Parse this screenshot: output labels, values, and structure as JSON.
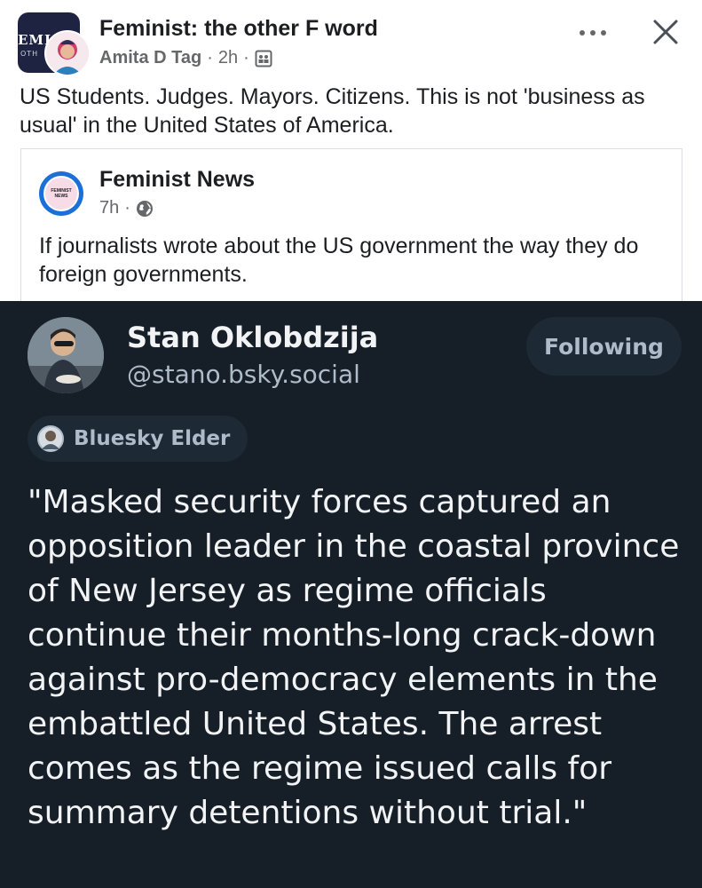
{
  "header": {
    "group_name": "Feminist: the other F word",
    "group_avatar_text": "EMI",
    "group_avatar_sub": "OTH",
    "author": "Amita D Tag",
    "separator": "·",
    "time": "2h",
    "audience_icon": "group-icon",
    "more_icon": "more-icon",
    "close_icon": "close-icon"
  },
  "post": {
    "text": "US Students. Judges. Mayors. Citizens. This is not 'business as usual' in the United States of America."
  },
  "shared": {
    "avatar_text_line1": "FEMINIST",
    "avatar_text_line2": "NEWS",
    "name": "Feminist News",
    "time": "7h",
    "separator": "·",
    "audience_icon": "globe-icon",
    "text": "If journalists wrote about the US government the way they do foreign governments."
  },
  "bluesky": {
    "name": "Stan Oklobdzija",
    "handle": "@stano.bsky.social",
    "follow_label": "Following",
    "badge_label": "Bluesky Elder",
    "lines": [
      "\"Masked security forces captured an",
      "opposition leader in the coastal province",
      "of New Jersey as regime officials",
      "continue their months-long crack-down",
      "against pro-democracy elements in the",
      "embattled United States. The arrest",
      "comes as the regime issued calls for",
      "summary detentions without trial.\""
    ]
  },
  "colors": {
    "text_primary": "#1c1e21",
    "text_secondary": "#65676b",
    "bluesky_bg": "#161e27",
    "bluesky_text": "#f1f3f5",
    "bluesky_muted": "#aebbc9",
    "bluesky_chip": "#1e2936"
  }
}
